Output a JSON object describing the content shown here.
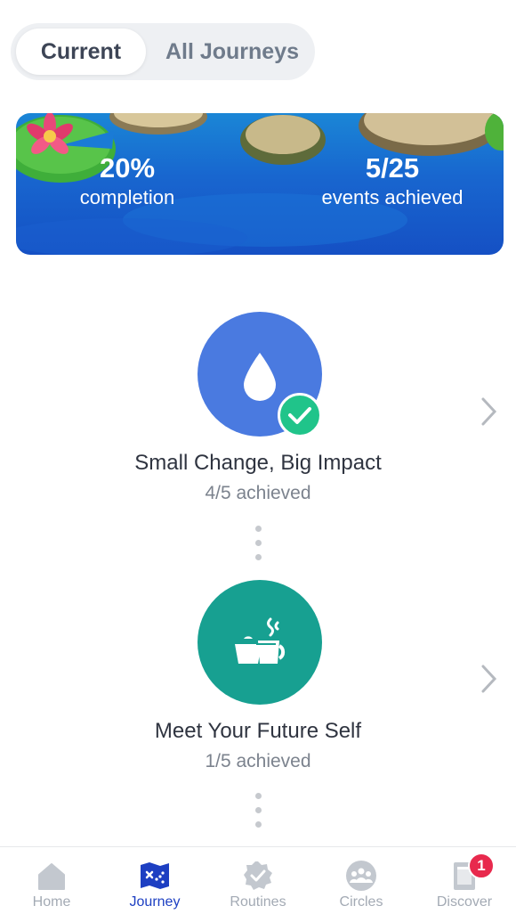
{
  "tabs": {
    "current": "Current",
    "all": "All Journeys"
  },
  "banner": {
    "completion_value": "20%",
    "completion_label": "completion",
    "events_value": "5/25",
    "events_label": "events achieved"
  },
  "journeys": [
    {
      "title": "Small Change, Big Impact",
      "progress": "4/5 achieved",
      "icon": "water-drop-icon",
      "color": "#4a7ae0",
      "completed": true
    },
    {
      "title": "Meet Your Future Self",
      "progress": "1/5 achieved",
      "icon": "tea-cup-icon",
      "color": "#17a091",
      "completed": false
    }
  ],
  "nav": {
    "items": [
      {
        "label": "Home",
        "icon": "home-icon"
      },
      {
        "label": "Journey",
        "icon": "journey-map-icon",
        "active": true
      },
      {
        "label": "Routines",
        "icon": "routines-check-icon"
      },
      {
        "label": "Circles",
        "icon": "circles-group-icon"
      },
      {
        "label": "Discover",
        "icon": "discover-icon"
      }
    ],
    "discover_badge": "1"
  },
  "colors": {
    "accent": "#1d3fc2",
    "banner_blue": "#1866cf",
    "check_green": "#20c48a"
  }
}
